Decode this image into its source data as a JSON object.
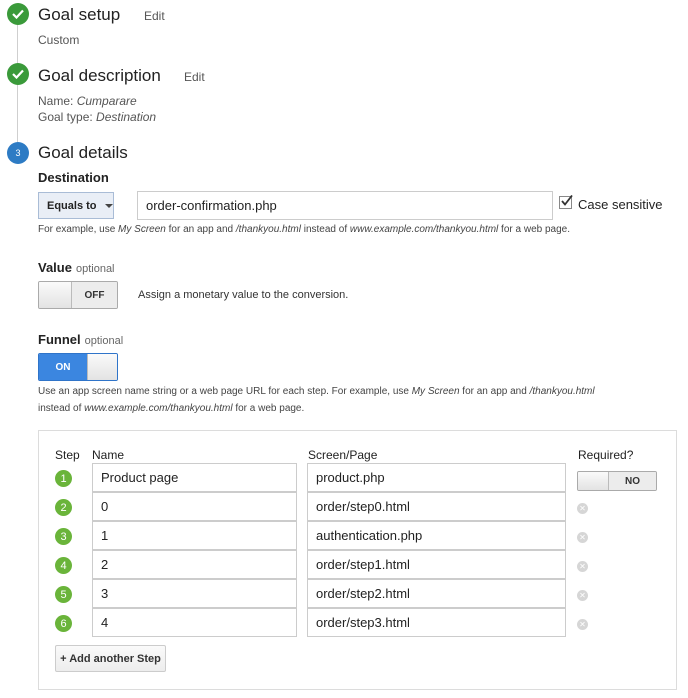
{
  "steps": [
    {
      "title": "Goal setup",
      "edit": "Edit",
      "lines": [
        {
          "value": "Custom"
        }
      ]
    },
    {
      "title": "Goal description",
      "edit": "Edit",
      "lines": [
        {
          "label": "Name:",
          "value": "Cumparare"
        },
        {
          "label": "Goal type:",
          "value": "Destination"
        }
      ]
    },
    {
      "number": "3",
      "title": "Goal details"
    }
  ],
  "destination": {
    "label": "Destination",
    "match_type": "Equals to",
    "value": "order-confirmation.php",
    "case_sensitive_label": "Case sensitive",
    "case_sensitive": true,
    "help": {
      "t1": "For example, use ",
      "i1": "My Screen",
      "t2": " for an app and ",
      "i2": "/thankyou.html",
      "t3": " instead of ",
      "i3": "www.example.com/thankyou.html",
      "t4": " for a web page."
    }
  },
  "value_section": {
    "label": "Value",
    "optional": "optional",
    "toggle": "OFF",
    "description": "Assign a monetary value to the conversion."
  },
  "funnel": {
    "label": "Funnel",
    "optional": "optional",
    "toggle": "ON",
    "help": {
      "t1": "Use an app screen name string or a web page URL for each step. For example, use ",
      "i1": "My Screen",
      "t2": " for an app and ",
      "i2": "/thankyou.html",
      "t3": "instead of ",
      "i3": "www.example.com/thankyou.html",
      "t4": " for a web page."
    },
    "columns": {
      "step": "Step",
      "name": "Name",
      "screen": "Screen/Page",
      "required": "Required?"
    },
    "rows": [
      {
        "step": "1",
        "name": "Product page",
        "screen": "product.php",
        "required": "NO"
      },
      {
        "step": "2",
        "name": "0",
        "screen": "order/step0.html"
      },
      {
        "step": "3",
        "name": "1",
        "screen": "authentication.php"
      },
      {
        "step": "4",
        "name": "2",
        "screen": "order/step1.html"
      },
      {
        "step": "5",
        "name": "3",
        "screen": "order/step2.html"
      },
      {
        "step": "6",
        "name": "4",
        "screen": "order/step3.html"
      }
    ],
    "add_step_label": "+ Add another Step"
  },
  "colors": {
    "done": "#3a9a3a",
    "current": "#2d7bc4",
    "step_badge": "#6ab43a",
    "toggle_on": "#3b86e0"
  },
  "icons": {
    "done": "check-icon",
    "remove": "remove-icon",
    "dropdown": "caret-down-icon"
  }
}
